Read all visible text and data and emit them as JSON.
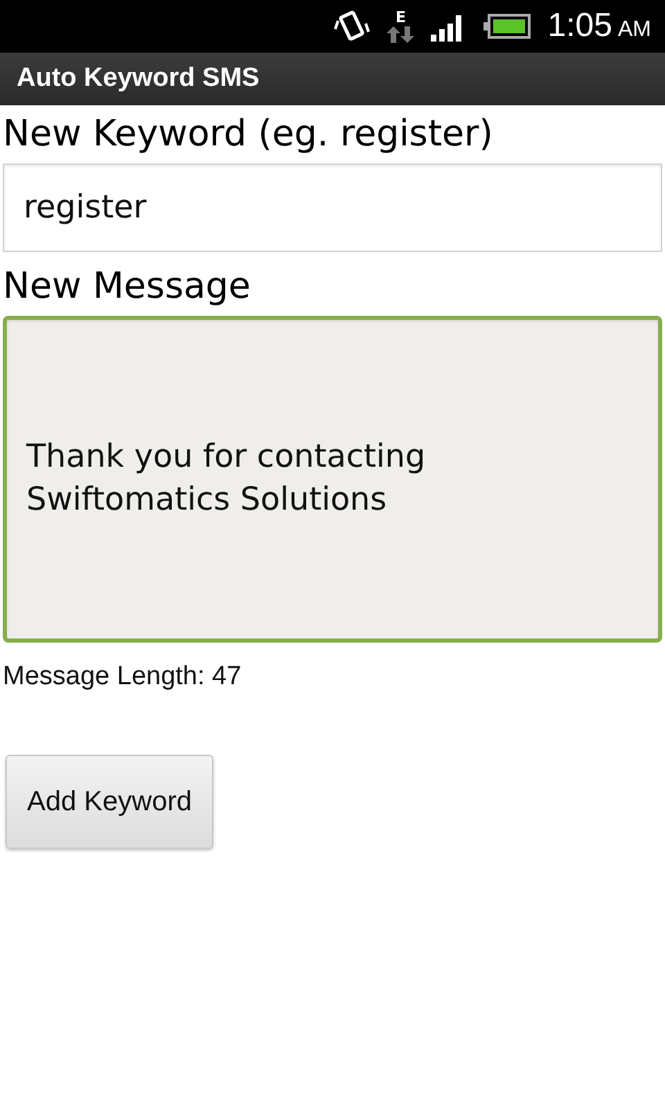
{
  "status_bar": {
    "network_type": "E",
    "time": "1:05",
    "meridiem": "AM"
  },
  "title_bar": {
    "title": "Auto Keyword SMS"
  },
  "keyword": {
    "label": "New Keyword (eg. register)",
    "value": "register",
    "focused": false
  },
  "message": {
    "label": "New Message",
    "value": "Thank you for contacting\nSwiftomatics Solutions",
    "focused": true
  },
  "length_text": "Message Length: 47",
  "buttons": [
    "Add Keyword"
  ]
}
